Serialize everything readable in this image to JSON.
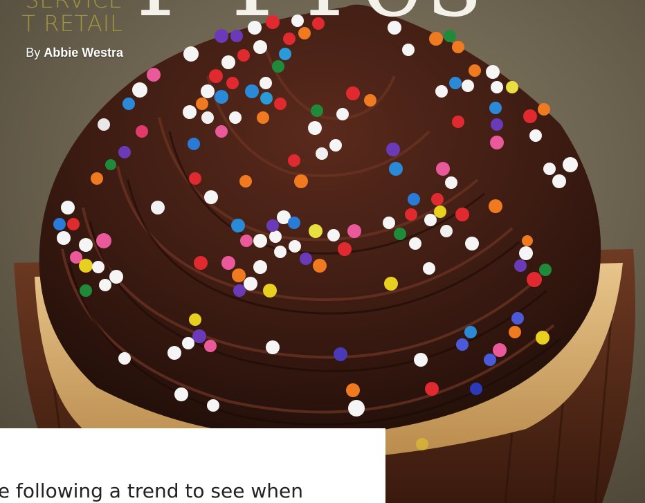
{
  "article": {
    "kicker_line1": "SERVICE",
    "kicker_line2": "T RETAIL",
    "byline_prefix": "By",
    "author": "Abbie Westra",
    "headline": "r Pres",
    "body_excerpt": "re following a trend to see when"
  },
  "photo": {
    "subject": "chocolate-frosted cupcake with rainbow sprinkles"
  },
  "colors": {
    "background": "#6d6451",
    "frosting": "#3a1a12",
    "cake": "#d9b478",
    "liner": "#5a2e1c",
    "kicker": "#b7aa3a",
    "card": "#ffffff"
  }
}
